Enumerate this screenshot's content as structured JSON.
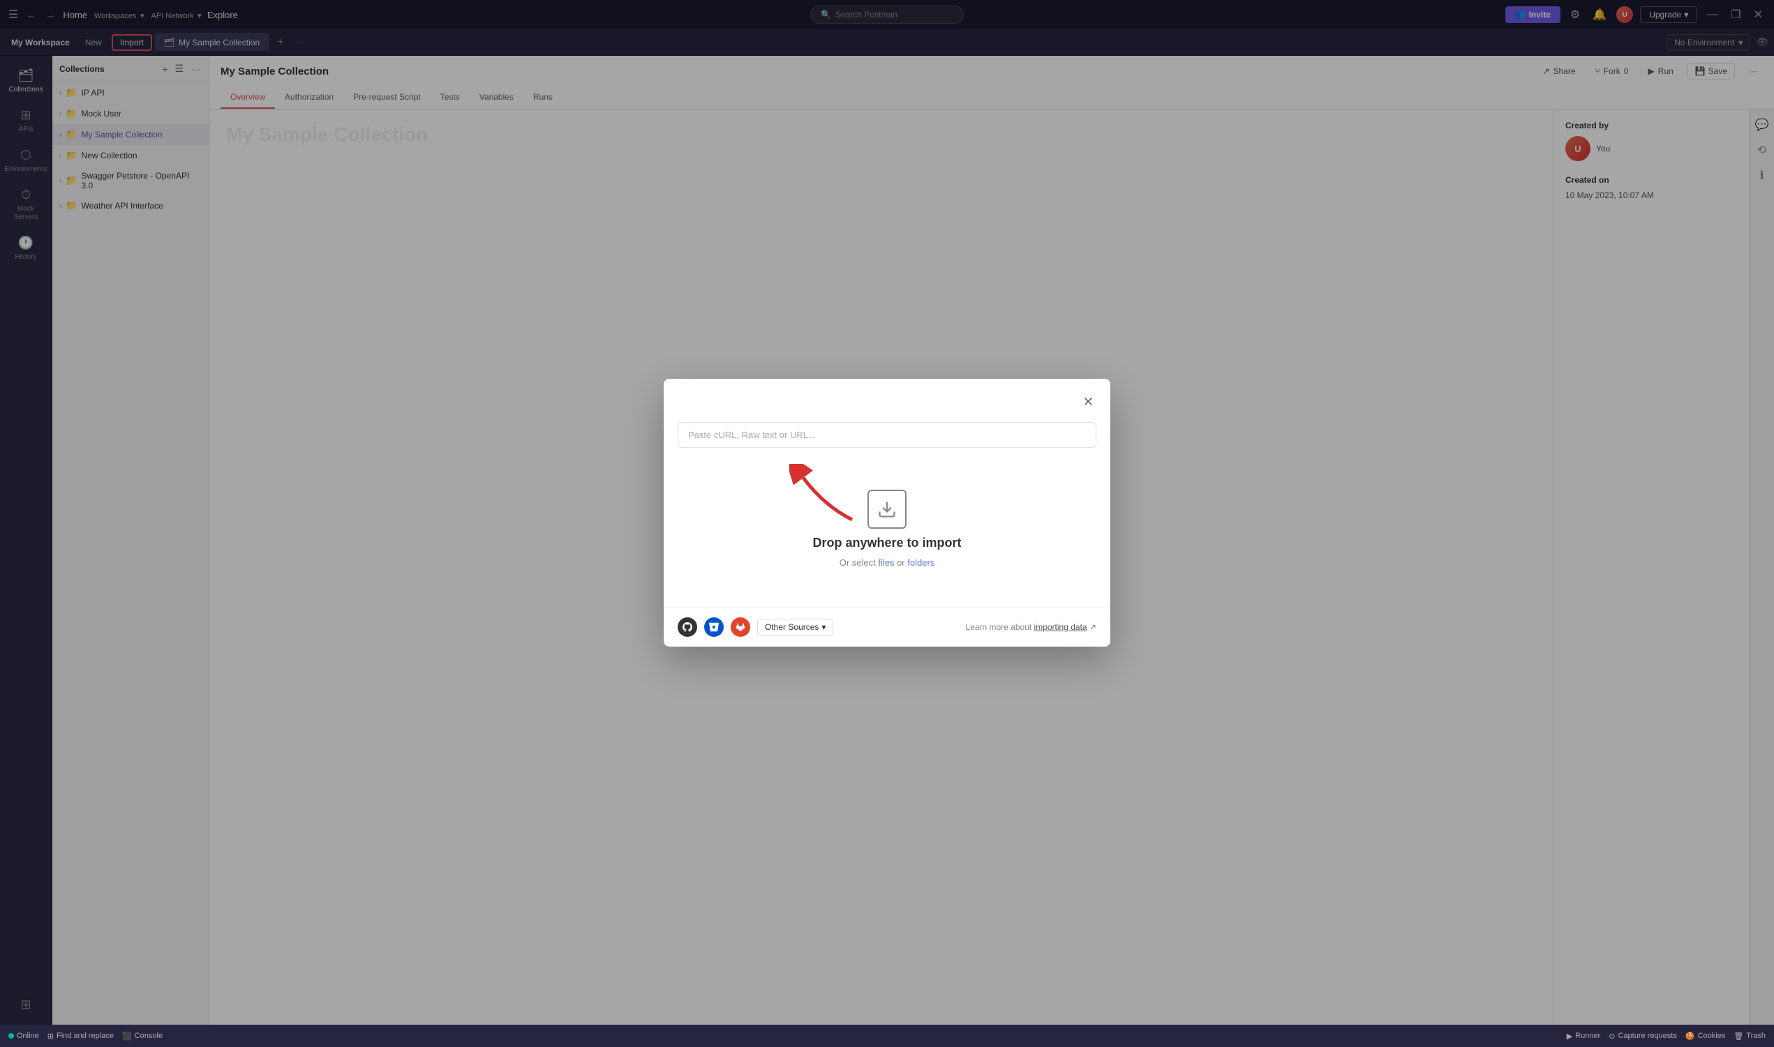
{
  "topbar": {
    "hamburger": "☰",
    "nav_back": "←",
    "nav_forward": "→",
    "home": "Home",
    "workspaces": "Workspaces",
    "workspaces_chevron": "▾",
    "api_network": "API Network",
    "api_network_chevron": "▾",
    "explore": "Explore",
    "search_placeholder": "Search Postman",
    "invite_label": "Invite",
    "settings_icon": "⚙",
    "bell_icon": "🔔",
    "upgrade_label": "Upgrade",
    "upgrade_chevron": "▾",
    "minimize": "—",
    "maximize": "❐",
    "close": "✕"
  },
  "tabbar": {
    "workspace_label": "My Workspace",
    "new_label": "New",
    "import_label": "Import",
    "collection_tab_label": "My Sample Collection",
    "collection_tab_icon": "🗂",
    "tab_plus": "+",
    "tab_more": "···",
    "no_env_label": "No Environment",
    "no_env_chevron": "▾"
  },
  "sidebar": {
    "items": [
      {
        "id": "collections",
        "icon": "🗂",
        "label": "Collections"
      },
      {
        "id": "apis",
        "icon": "⊞",
        "label": "APIs"
      },
      {
        "id": "environments",
        "icon": "⬡",
        "label": "Environments"
      },
      {
        "id": "mock-servers",
        "icon": "⏱",
        "label": "Mock Servers"
      },
      {
        "id": "history",
        "icon": "🕐",
        "label": "History"
      }
    ],
    "bottom_item": {
      "id": "extensions",
      "icon": "⊞+",
      "label": ""
    }
  },
  "collections_panel": {
    "title": "Collections",
    "add_icon": "+",
    "filter_icon": "☰",
    "more_icon": "···",
    "items": [
      {
        "id": "ip-api",
        "label": "IP API",
        "active": false
      },
      {
        "id": "mock-user",
        "label": "Mock User",
        "active": false
      },
      {
        "id": "my-sample",
        "label": "My Sample Collection",
        "active": true
      },
      {
        "id": "new-collection",
        "label": "New Collection",
        "active": false
      },
      {
        "id": "swagger",
        "label": "Swagger Petstore - OpenAPI 3.0",
        "active": false
      },
      {
        "id": "weather",
        "label": "Weather API Interface",
        "active": false
      }
    ]
  },
  "content": {
    "title": "My Sample Collection",
    "tabs": [
      {
        "id": "overview",
        "label": "Overview",
        "active": true
      },
      {
        "id": "authorization",
        "label": "Authorization",
        "active": false
      },
      {
        "id": "pre-request",
        "label": "Pre-request Script",
        "active": false
      },
      {
        "id": "tests",
        "label": "Tests",
        "active": false
      },
      {
        "id": "variables",
        "label": "Variables",
        "active": false
      },
      {
        "id": "runs",
        "label": "Runs",
        "active": false
      }
    ],
    "share_label": "Share",
    "fork_label": "Fork",
    "fork_count": "0",
    "run_label": "Run",
    "save_label": "Save",
    "more_label": "···",
    "collection_title_display": "My Sample Collection",
    "right_panel": {
      "created_by_label": "Created by",
      "created_by_value": "You",
      "created_on_label": "Created on",
      "created_on_value": "10 May 2023, 10:07 AM"
    }
  },
  "modal": {
    "close_icon": "✕",
    "input_placeholder": "Paste cURL, Raw text or URL...",
    "drop_title": "Drop anywhere to import",
    "drop_sub_start": "Or select ",
    "drop_files_link": "files",
    "drop_sub_mid": " or ",
    "drop_folders_link": "folders",
    "sources": [
      {
        "id": "github",
        "icon": "⬡",
        "label": "GitHub"
      },
      {
        "id": "bitbucket",
        "icon": "⚑",
        "label": "Bitbucket"
      },
      {
        "id": "gitlab",
        "icon": "🦊",
        "label": "GitLab"
      }
    ],
    "other_sources_label": "Other Sources",
    "other_sources_chevron": "▾",
    "import_link_label": "Learn more about ",
    "import_link_text": "importing data",
    "import_link_arrow": "↗"
  },
  "statusbar": {
    "online_label": "Online",
    "find_replace_label": "Find and replace",
    "console_label": "Console",
    "runner_label": "Runner",
    "capture_label": "Capture requests",
    "cookies_label": "Cookies",
    "trash_label": "Trash"
  }
}
